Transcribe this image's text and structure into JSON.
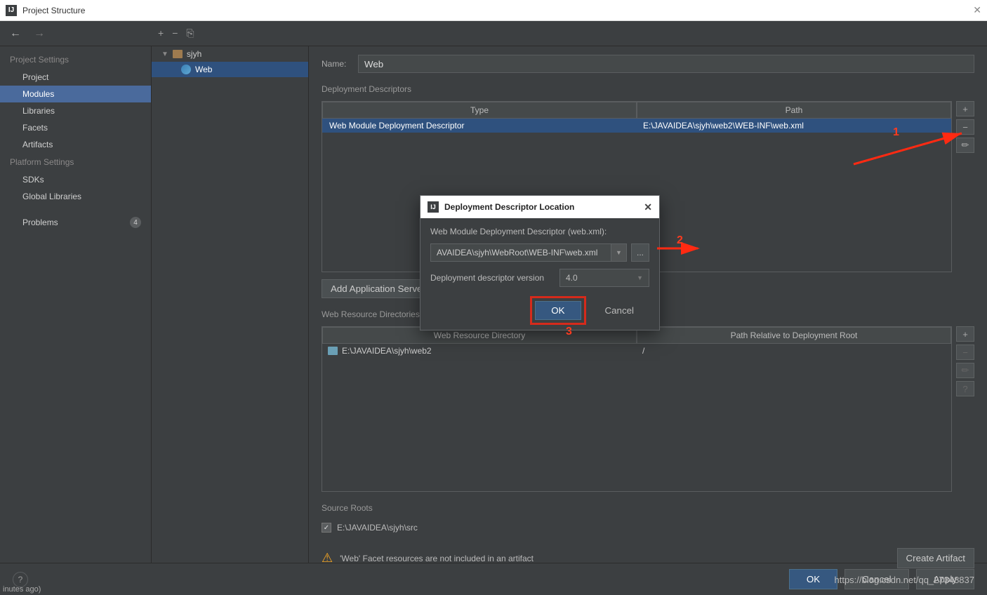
{
  "window_title": "Project Structure",
  "nav": {
    "project_settings_label": "Project Settings",
    "items": {
      "project": "Project",
      "modules": "Modules",
      "libraries": "Libraries",
      "facets": "Facets",
      "artifacts": "Artifacts"
    },
    "platform_settings_label": "Platform Settings",
    "platform_items": {
      "sdks": "SDKs",
      "global_libraries": "Global Libraries"
    },
    "problems_label": "Problems",
    "problems_count": "4"
  },
  "tree": {
    "root": "sjyh",
    "child": "Web"
  },
  "form": {
    "name_label": "Name:",
    "name_value": "Web",
    "deploy_desc_label": "Deployment Descriptors",
    "table1": {
      "col1": "Type",
      "col2": "Path",
      "row_type": "Web Module Deployment Descriptor",
      "row_path": "E:\\JAVAIDEA\\sjyh\\web2\\WEB-INF\\web.xml"
    },
    "add_app_server": "Add Application Server specific descriptor...",
    "webres_label": "Web Resource Directories",
    "table2": {
      "col1": "Web Resource Directory",
      "col2": "Path Relative to Deployment Root",
      "row_dir": "E:\\JAVAIDEA\\sjyh\\web2",
      "row_path": "/"
    },
    "source_roots_label": "Source Roots",
    "source_root": "E:\\JAVAIDEA\\sjyh\\src",
    "warning": "'Web' Facet resources are not included in an artifact",
    "create_artifact": "Create Artifact"
  },
  "footer": {
    "ok": "OK",
    "cancel": "Cancel",
    "apply": "Apply"
  },
  "status_cut": "inutes ago)",
  "modal": {
    "title": "Deployment Descriptor Location",
    "label1": "Web Module Deployment Descriptor (web.xml):",
    "path_value": "AVAIDEA\\sjyh\\WebRoot\\WEB-INF\\web.xml",
    "browse": "...",
    "version_label": "Deployment descriptor version",
    "version_value": "4.0",
    "ok": "OK",
    "cancel": "Cancel"
  },
  "annotations": {
    "n1": "1",
    "n2": "2",
    "n3": "3"
  },
  "watermark": "https://blog.csdn.net/qq_27348837"
}
